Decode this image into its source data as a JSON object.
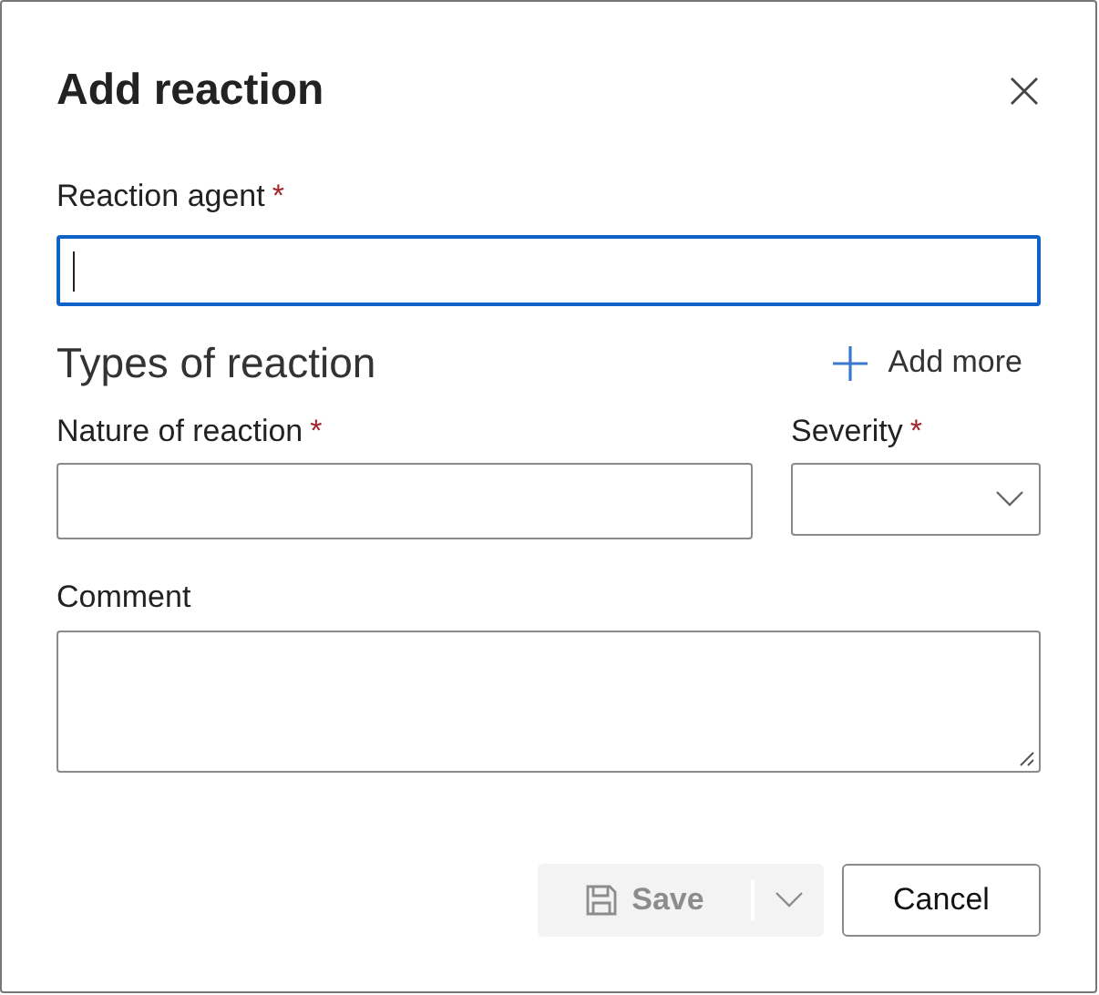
{
  "dialog": {
    "title": "Add reaction"
  },
  "reaction_agent": {
    "label": "Reaction agent",
    "required_mark": "*",
    "focused": true,
    "kind": "text"
  },
  "types_section": {
    "heading": "Types of reaction",
    "add_more": "Add more"
  },
  "type_fields": [
    {
      "label": "Nature of reaction",
      "required_mark": "*",
      "focused": false,
      "kind": "text"
    },
    {
      "label": "Severity",
      "required_mark": "*",
      "focused": false,
      "kind": "select"
    }
  ],
  "comment": {
    "label": "Comment",
    "focused": false,
    "kind": "textarea"
  },
  "buttons": [
    {
      "label": "Save",
      "kind": "split",
      "disabled": true
    },
    {
      "label": "Cancel",
      "kind": "plain",
      "disabled": false
    }
  ]
}
